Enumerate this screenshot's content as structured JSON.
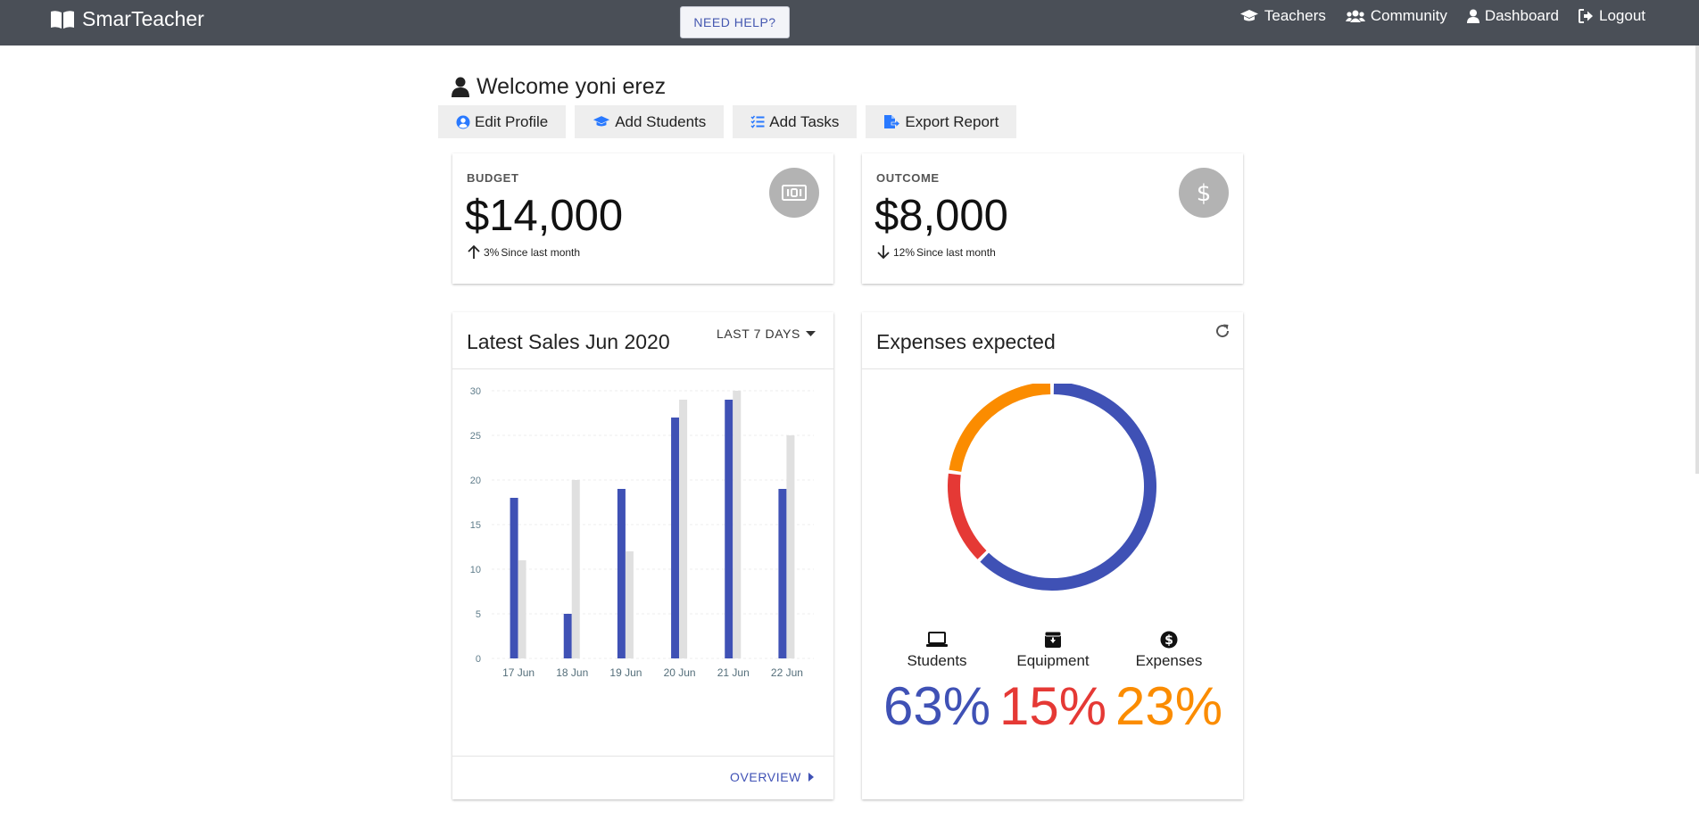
{
  "app": {
    "title": "SmarTeacher",
    "help_label": "NEED HELP?"
  },
  "nav": [
    {
      "label": "Teachers",
      "icon": "graduation-cap-icon"
    },
    {
      "label": "Community",
      "icon": "users-icon"
    },
    {
      "label": "Dashboard",
      "icon": "user-icon"
    },
    {
      "label": "Logout",
      "icon": "sign-out-icon"
    }
  ],
  "welcome": "Welcome yoni erez",
  "actions": [
    {
      "label": "Edit Profile",
      "icon": "user-circle-icon"
    },
    {
      "label": "Add Students",
      "icon": "graduation-cap-icon"
    },
    {
      "label": "Add Tasks",
      "icon": "task-list-icon"
    },
    {
      "label": "Export Report",
      "icon": "file-export-icon"
    }
  ],
  "budget": {
    "label": "BUDGET",
    "value": "$14,000",
    "trend_pct": "3%",
    "trend_text": "Since last month",
    "trend_dir": "up",
    "icon": "money-bill-icon"
  },
  "outcome": {
    "label": "OUTCOME",
    "value": "$8,000",
    "trend_pct": "12%",
    "trend_text": "Since last month",
    "trend_dir": "down",
    "icon": "dollar-icon"
  },
  "sales": {
    "title": "Latest Sales Jun 2020",
    "range_label": "LAST 7 DAYS",
    "overview_label": "OVERVIEW"
  },
  "expenses": {
    "title": "Expenses expected",
    "items": [
      {
        "label": "Students",
        "value": "63%",
        "color": "#3f51b5",
        "icon": "laptop-icon"
      },
      {
        "label": "Equipment",
        "value": "15%",
        "color": "#e53935",
        "icon": "archive-icon"
      },
      {
        "label": "Expenses",
        "value": "23%",
        "color": "#fb8c00",
        "icon": "dollar-circle-icon"
      }
    ]
  },
  "chart_data": [
    {
      "type": "bar",
      "categories": [
        "17 Jun",
        "18 Jun",
        "19 Jun",
        "20 Jun",
        "21 Jun",
        "22 Jun"
      ],
      "series": [
        {
          "values": [
            18,
            5,
            19,
            27,
            29,
            19
          ],
          "color": "#3f51b5"
        },
        {
          "values": [
            11,
            20,
            12,
            29,
            30,
            25
          ],
          "color": "#e0e0e0"
        }
      ],
      "yticks": [
        0,
        5,
        10,
        15,
        20,
        25,
        30
      ],
      "ylim": [
        0,
        30
      ],
      "grid": true
    },
    {
      "type": "pie",
      "variant": "doughnut",
      "categories": [
        "Students",
        "Equipment",
        "Expenses"
      ],
      "values": [
        63,
        15,
        23
      ],
      "colors": [
        "#3f51b5",
        "#e53935",
        "#fb8c00"
      ]
    }
  ]
}
